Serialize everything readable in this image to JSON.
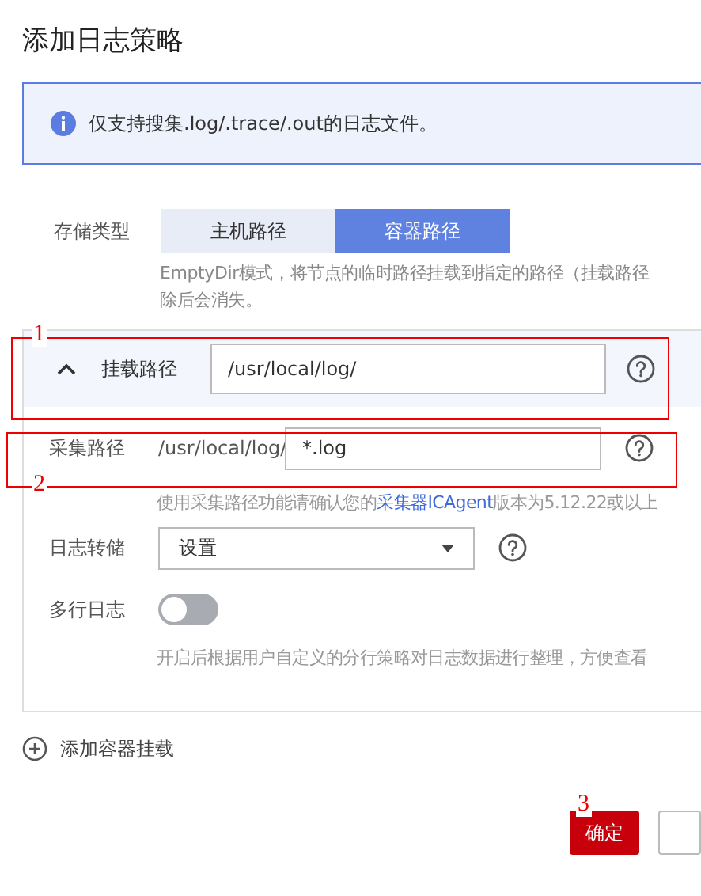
{
  "title": "添加日志策略",
  "notice": {
    "text": "仅支持搜集.log/.trace/.out的日志文件。"
  },
  "storage_type": {
    "label": "存储类型",
    "options": [
      {
        "label": "主机路径",
        "selected": false
      },
      {
        "label": "容器路径",
        "selected": true
      }
    ],
    "description": [
      "EmptyDir模式，将节点的临时路径挂载到指定的路径（挂载路径",
      "除后会消失。"
    ]
  },
  "mount": {
    "expanded": true,
    "label": "挂载路径",
    "value": "/usr/local/log/"
  },
  "collect_path": {
    "label": "采集路径",
    "prefix": "/usr/local/log/",
    "value": "*.log",
    "hint_before": "使用采集路径功能请确认您的",
    "hint_link": "采集器ICAgent",
    "hint_after": "版本为5.12.22或以上"
  },
  "log_dump": {
    "label": "日志转储",
    "value": "设置"
  },
  "multiline": {
    "label": "多行日志",
    "on": false,
    "hint": "开启后根据用户自定义的分行策略对日志数据进行整理，方便查看"
  },
  "add_mount": "添加容器挂载",
  "confirm": "确定",
  "annotations": [
    {
      "label": "1"
    },
    {
      "label": "2"
    },
    {
      "label": "3"
    }
  ]
}
